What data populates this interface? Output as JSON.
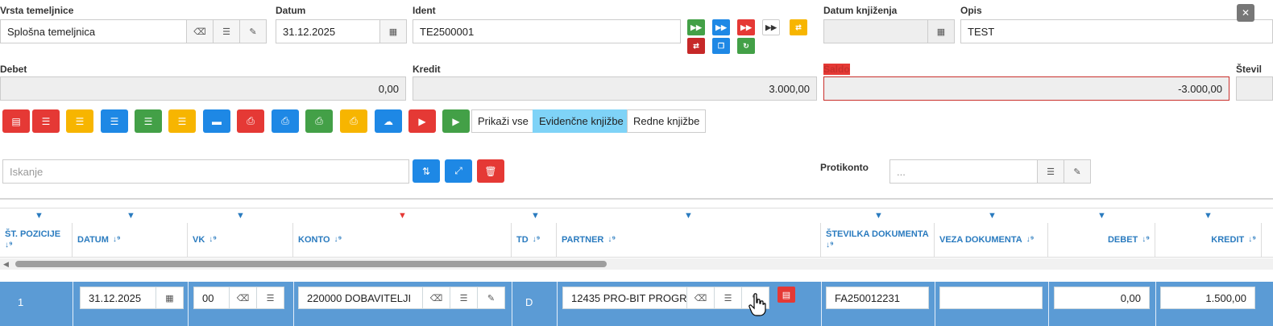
{
  "header": {
    "vrsta_label": "Vrsta temeljnice",
    "vrsta_value": "Splošna temeljnica",
    "datum_label": "Datum",
    "datum_value": "31.12.2025",
    "ident_label": "Ident",
    "ident_value": "TE2500001",
    "datum_knjizenja_label": "Datum knjiženja",
    "datum_knjizenja_value": "",
    "opis_label": "Opis",
    "opis_value": "TEST",
    "close_glyph": "✕"
  },
  "totals": {
    "debet_label": "Debet",
    "debet_value": "0,00",
    "kredit_label": "Kredit",
    "kredit_value": "3.000,00",
    "saldo_label": "Saldo",
    "saldo_value": "-3.000,00",
    "stevilo_label": "Števil"
  },
  "toolbar": {
    "show_all": "Prikaži vse",
    "evidencne": "Evidenčne knjižbe",
    "redne": "Redne knjižbe"
  },
  "search": {
    "placeholder": "Iskanje",
    "protikonto_label": "Protikonto",
    "protikonto_placeholder": "..."
  },
  "table": {
    "columns": [
      "ŠT. POZICIJE",
      "DATUM",
      "VK",
      "KONTO",
      "TD",
      "PARTNER",
      "ŠTEVILKA DOKUMENTA",
      "VEZA DOKUMENTA",
      "DEBET",
      "KREDIT"
    ],
    "row": {
      "pozicija": "1",
      "datum": "31.12.2025",
      "vk": "00",
      "konto": "220000 DOBAVITELJI ",
      "td": "D",
      "partner": "12435 PRO-BIT PROGR",
      "stevilka_dokumenta": "FA250012231",
      "veza_dokumenta": "",
      "debet": "0,00",
      "kredit": "1.500,00"
    }
  },
  "colors": {
    "accent": "#1e88e5",
    "selected_row": "#5b9bd5",
    "danger": "#e53935",
    "success": "#43a047",
    "warning": "#f7b500",
    "active_segment": "#7fd3f7"
  }
}
